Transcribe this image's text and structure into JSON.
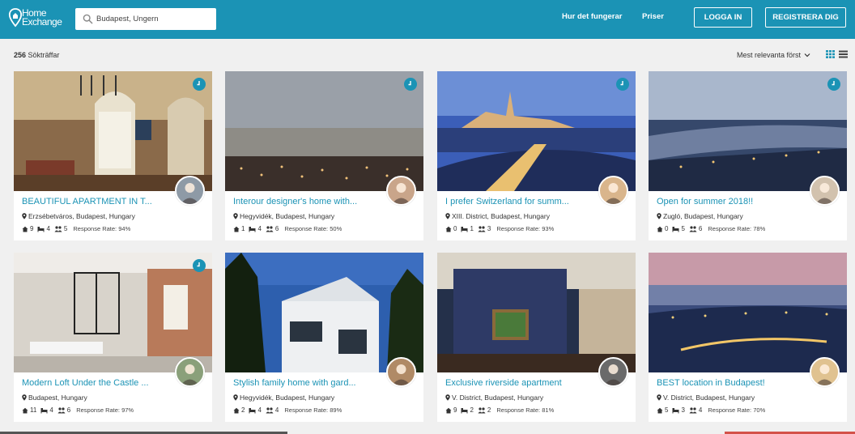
{
  "brand": {
    "logo_text_line1": "Home",
    "logo_text_line2": "Exchange",
    "accent": "#1b93b5"
  },
  "search": {
    "value": "Budapest, Ungern",
    "icon": "search-icon"
  },
  "nav": {
    "how_it_works": "Hur det fungerar",
    "prices": "Priser",
    "login": "LOGGA IN",
    "register": "REGISTRERA DIG"
  },
  "toolbar": {
    "results_count": "256",
    "results_label": " Sökträffar",
    "sort_label": "Mest relevanta först",
    "sort_icon": "chevron-down-icon",
    "view_icons": [
      "grid-view-icon",
      "list-view-icon"
    ]
  },
  "listings": [
    {
      "title": "BEAUTIFUL APARTMENT IN T...",
      "location": "Erzsébetváros, Budapest, Hungary",
      "beds": "9",
      "rooms": "4",
      "guests": "5",
      "response": "Response Rate: 94%",
      "clock": true
    },
    {
      "title": "Interour designer's home with...",
      "location": "Hegyvidék, Budapest, Hungary",
      "beds": "1",
      "rooms": "4",
      "guests": "6",
      "response": "Response Rate: 50%",
      "clock": true
    },
    {
      "title": "I prefer Switzerland for summ...",
      "location": "XIII. District, Budapest, Hungary",
      "beds": "0",
      "rooms": "1",
      "guests": "3",
      "response": "Response Rate: 93%",
      "clock": true
    },
    {
      "title": "Open for summer 2018!!",
      "location": "Zugló, Budapest, Hungary",
      "beds": "0",
      "rooms": "5",
      "guests": "6",
      "response": "Response Rate: 78%",
      "clock": true
    },
    {
      "title": "Modern Loft Under the Castle ...",
      "location": "Budapest, Hungary",
      "beds": "11",
      "rooms": "4",
      "guests": "6",
      "response": "Response Rate: 97%",
      "clock": true
    },
    {
      "title": "Stylish family home with gard...",
      "location": "Hegyvidék, Budapest, Hungary",
      "beds": "2",
      "rooms": "4",
      "guests": "4",
      "response": "Response Rate: 89%",
      "clock": false
    },
    {
      "title": "Exclusive riverside apartment",
      "location": "V. District, Budapest, Hungary",
      "beds": "9",
      "rooms": "2",
      "guests": "2",
      "response": "Response Rate: 81%",
      "clock": false
    },
    {
      "title": "BEST location in Budapest!",
      "location": "V. District, Budapest, Hungary",
      "beds": "5",
      "rooms": "3",
      "guests": "4",
      "response": "Response Rate: 70%",
      "clock": false
    }
  ]
}
